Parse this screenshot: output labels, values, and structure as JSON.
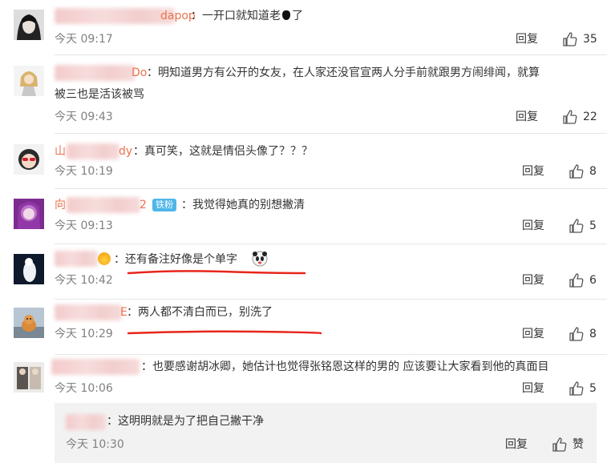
{
  "colors": {
    "accent": "#eb7350",
    "underline": "#e8251b",
    "badge": "#4eb6e9",
    "divider": "#e6e6e6"
  },
  "reply_label": "回复",
  "comments": [
    {
      "name_tail": "dapop",
      "text": "：一开口就知道老",
      "text_after": "了",
      "time": "今天 09:17",
      "likes": "35"
    },
    {
      "name_tail": "Do",
      "text": "：明知道男方有公开的女友，在人家还没官宣两人分手前就跟男方闹绯闻，就算",
      "text2": "被三也是活该被骂",
      "time": "今天 09:43",
      "likes": "22"
    },
    {
      "name_tail_start": "山",
      "name_tail": "dy",
      "text": "：真可笑，这就是情侣头像了？？？",
      "time": "今天 10:19",
      "likes": "8"
    },
    {
      "name_tail_start": "向",
      "name_tail": "2",
      "badge": "铁粉",
      "text": "：我觉得她真的别想撇清",
      "time": "今天 09:13",
      "likes": "5"
    },
    {
      "text": "：还有备注好像是个单字",
      "time": "今天 10:42",
      "likes": "6"
    },
    {
      "name_tail": "E",
      "text": "：两人都不清白而已，别洗了",
      "time": "今天 10:29",
      "likes": "8"
    },
    {
      "text": "：也要感谢胡冰卿，她估计也觉得张铭恩这样的男的 应该要让大家看到他的真面目",
      "time": "今天 10:06",
      "likes": "5"
    }
  ],
  "sub_reply": {
    "text": "：这明明就是为了把自己撇干净",
    "time": "今天 10:30",
    "like_label": "赞"
  }
}
